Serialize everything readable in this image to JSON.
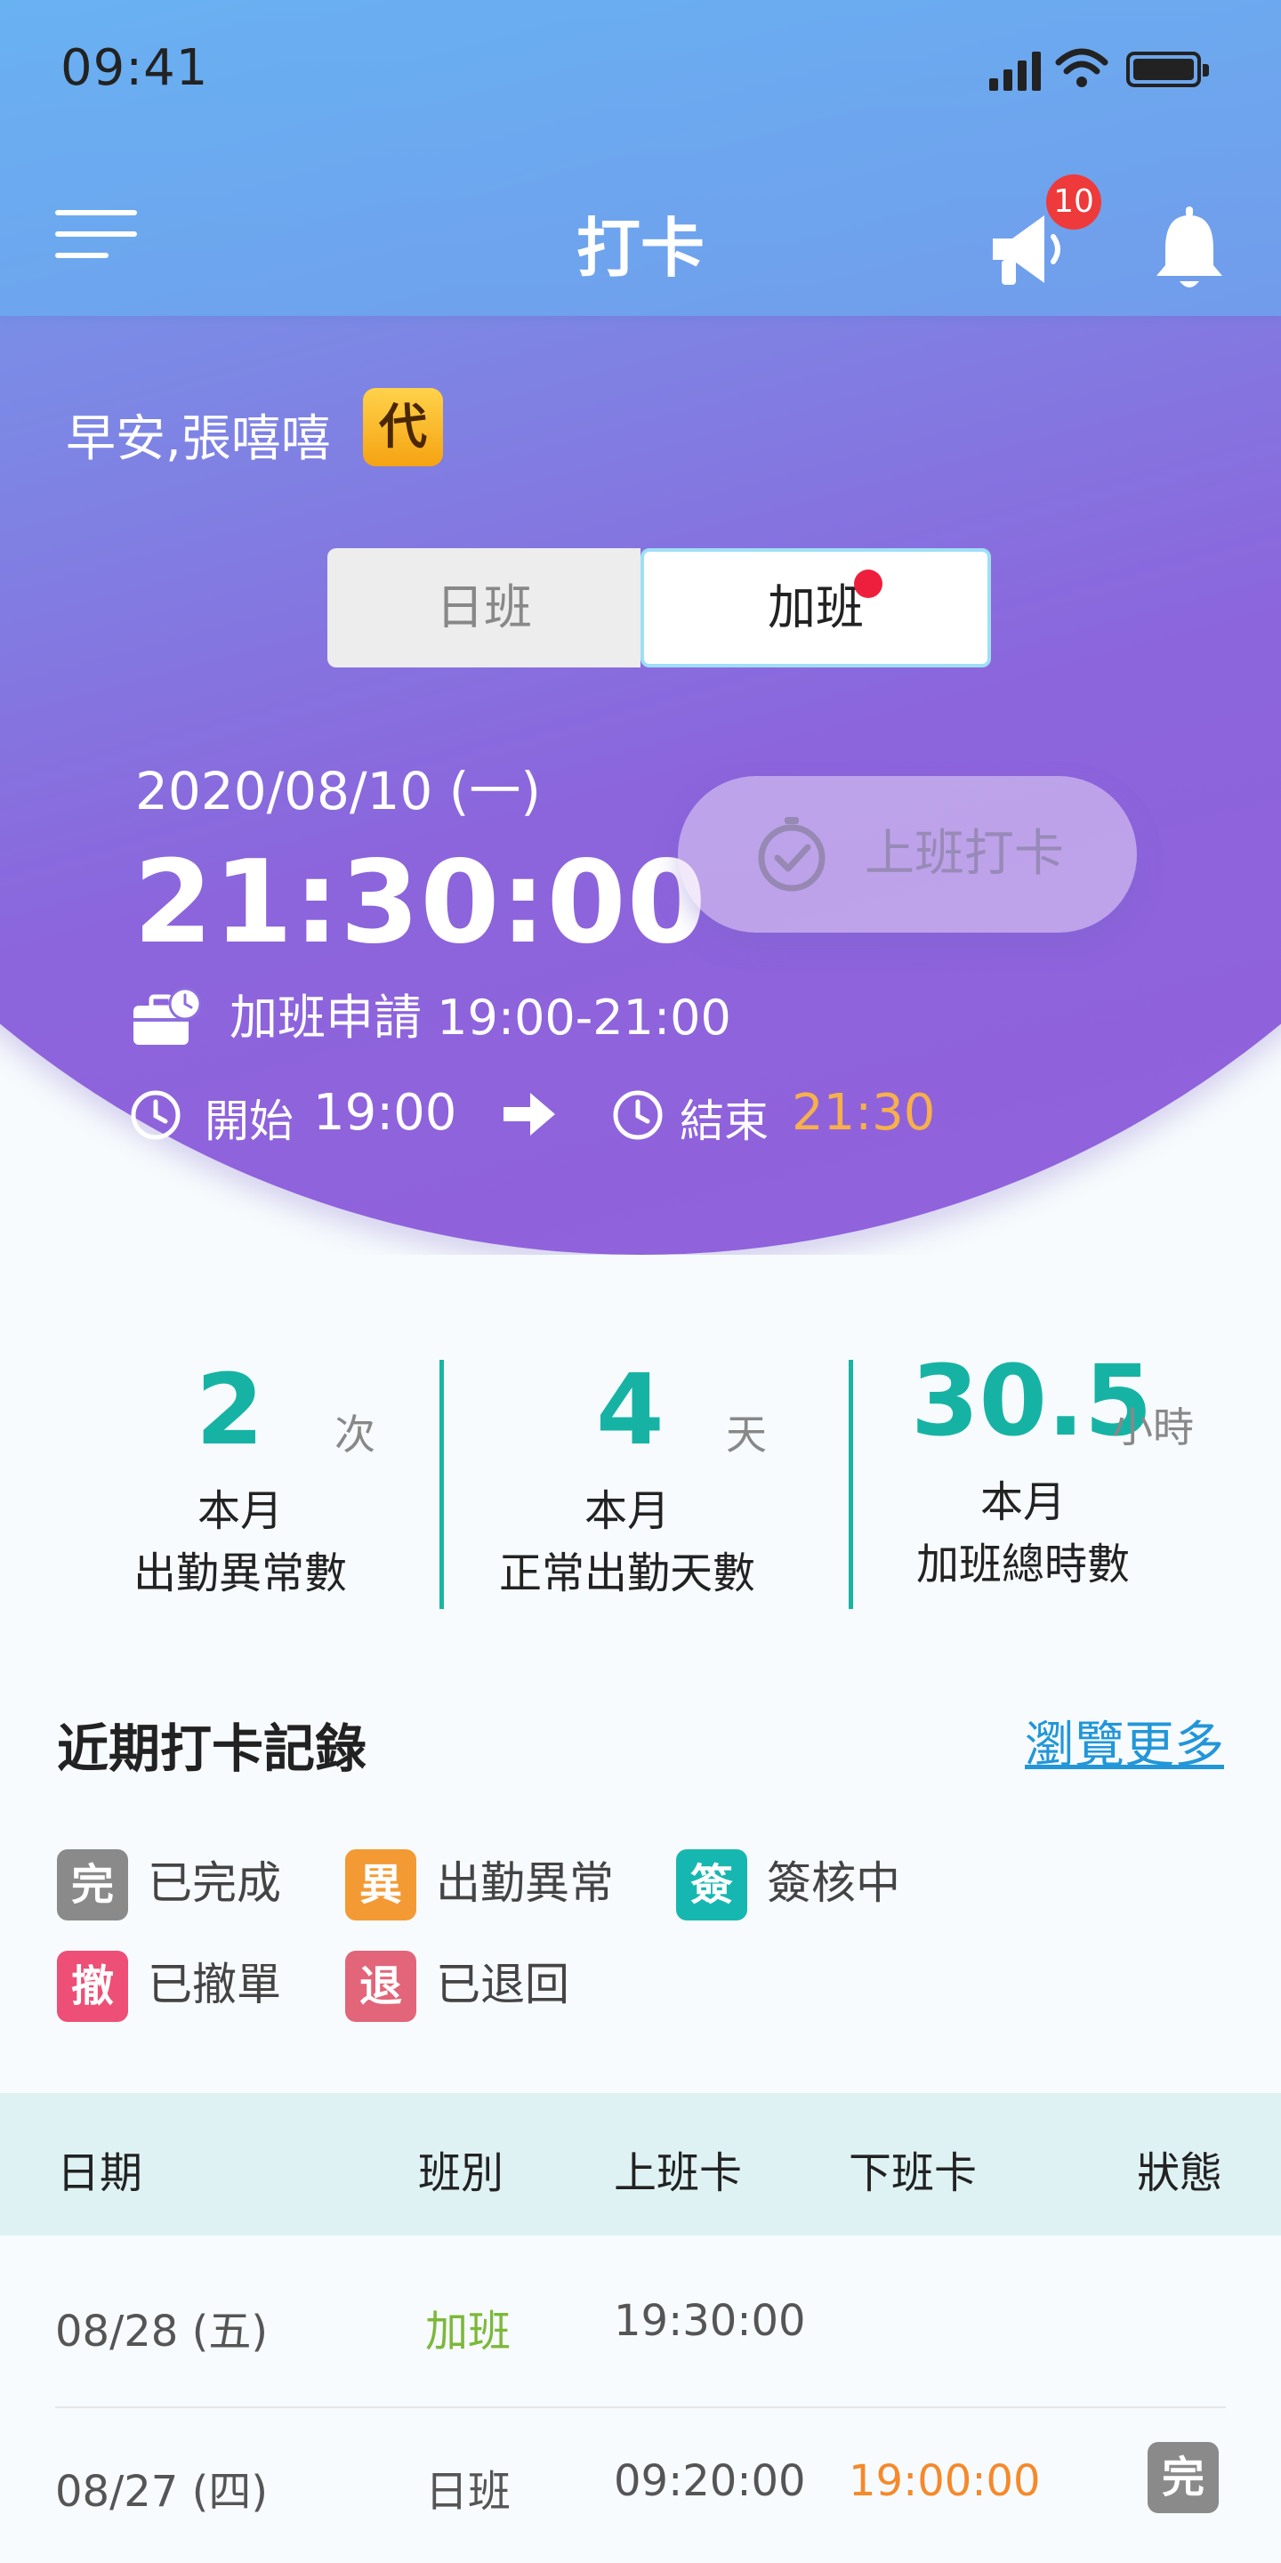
{
  "status_bar": {
    "time": "09:41"
  },
  "header": {
    "title": "打卡",
    "announcement_count": "10"
  },
  "greeting": "早安,張嘻嘻",
  "proxy_tag": "代",
  "shift_tabs": [
    {
      "label": "日班",
      "selected": false
    },
    {
      "label": "加班",
      "selected": true,
      "has_dot": true
    }
  ],
  "current": {
    "date": "2020/08/10 (一)",
    "time": "21:30:00",
    "punch_button": "上班打卡",
    "overtime_request": "加班申請 19:00-21:00",
    "start_label": "開始",
    "start_time": "19:00",
    "end_label": "結束",
    "end_time": "21:30"
  },
  "stats": [
    {
      "value": "2",
      "unit": "次",
      "caption_line1": "本月",
      "caption_line2": "出勤異常數"
    },
    {
      "value": "4",
      "unit": "天",
      "caption_line1": "本月",
      "caption_line2": "正常出勤天數"
    },
    {
      "value": "30.5",
      "unit": "小時",
      "caption_line1": "本月",
      "caption_line2": "加班總時數"
    }
  ],
  "records": {
    "title": "近期打卡記錄",
    "more_link": "瀏覽更多",
    "legend": [
      {
        "tag": "完",
        "label": "已完成",
        "color": "#8a8a8a"
      },
      {
        "tag": "異",
        "label": "出勤異常",
        "color": "#f39a34"
      },
      {
        "tag": "簽",
        "label": "簽核中",
        "color": "#17b7b1"
      },
      {
        "tag": "撤",
        "label": "已撤單",
        "color": "#ee4f76"
      },
      {
        "tag": "退",
        "label": "已退回",
        "color": "#e26579"
      }
    ],
    "columns": [
      "日期",
      "班別",
      "上班卡",
      "下班卡",
      "狀態"
    ],
    "rows": [
      {
        "date": "08/28 (五)",
        "shift": "加班",
        "clock_in": "19:30:00",
        "clock_out": "",
        "status": ""
      },
      {
        "date": "08/27 (四)",
        "shift": "日班",
        "clock_in": "09:20:00",
        "clock_out": "19:00:00",
        "status": "完"
      }
    ]
  },
  "colors": {
    "accent_teal": "#16b3a5",
    "overtime_green": "#7cb83a",
    "late_orange": "#f5892b",
    "end_time_orange": "#f7b04a",
    "link_blue": "#2296d8"
  }
}
